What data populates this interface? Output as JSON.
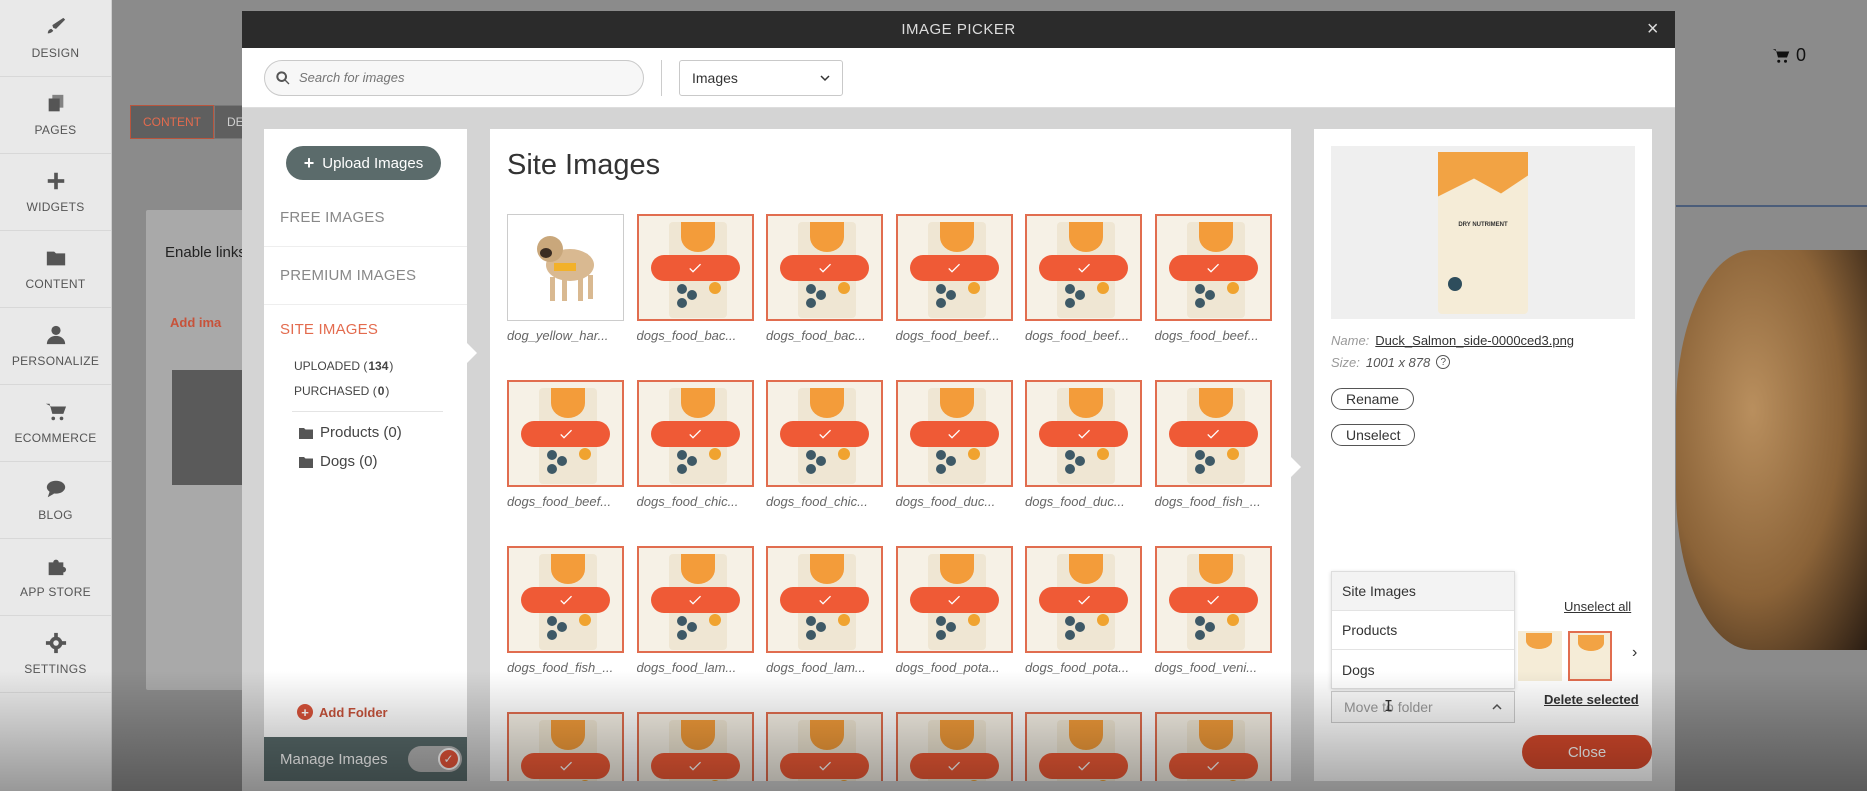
{
  "sidebar": {
    "items": [
      {
        "label": "DESIGN",
        "icon": "brush-icon"
      },
      {
        "label": "PAGES",
        "icon": "pages-icon"
      },
      {
        "label": "WIDGETS",
        "icon": "plus-icon"
      },
      {
        "label": "CONTENT",
        "icon": "folder-icon"
      },
      {
        "label": "PERSONALIZE",
        "icon": "person-icon"
      },
      {
        "label": "ECOMMERCE",
        "icon": "cart-icon"
      },
      {
        "label": "BLOG",
        "icon": "chat-icon"
      },
      {
        "label": "APP STORE",
        "icon": "puzzle-icon"
      },
      {
        "label": "SETTINGS",
        "icon": "gear-icon"
      }
    ]
  },
  "background": {
    "tab_content": "CONTENT",
    "tab_design": "DE",
    "enable_links": "Enable links",
    "add_image": "Add ima",
    "cart_count": "0"
  },
  "modal": {
    "title": "IMAGE PICKER",
    "close_icon": "×",
    "search_placeholder": "Search for images",
    "filter_selected": "Images",
    "upload_label": "Upload Images",
    "nav": {
      "free": "FREE IMAGES",
      "premium": "PREMIUM IMAGES",
      "site": "SITE IMAGES",
      "uploaded_label": "UPLOADED",
      "uploaded_count": "134",
      "purchased_label": "PURCHASED",
      "purchased_count": "0"
    },
    "folders": [
      {
        "name": "Products (0)"
      },
      {
        "name": "Dogs (0)"
      }
    ],
    "add_folder": "Add Folder",
    "manage_images": "Manage Images",
    "grid_title": "Site Images",
    "images": [
      {
        "name": "dog_yellow_har...",
        "selected": false,
        "kind": "pug"
      },
      {
        "name": "dogs_food_bac...",
        "selected": true,
        "kind": "bag"
      },
      {
        "name": "dogs_food_bac...",
        "selected": true,
        "kind": "bag"
      },
      {
        "name": "dogs_food_beef...",
        "selected": true,
        "kind": "bag"
      },
      {
        "name": "dogs_food_beef...",
        "selected": true,
        "kind": "bag"
      },
      {
        "name": "dogs_food_beef...",
        "selected": true,
        "kind": "bag"
      },
      {
        "name": "dogs_food_beef...",
        "selected": true,
        "kind": "bag"
      },
      {
        "name": "dogs_food_chic...",
        "selected": true,
        "kind": "bag"
      },
      {
        "name": "dogs_food_chic...",
        "selected": true,
        "kind": "bag"
      },
      {
        "name": "dogs_food_duc...",
        "selected": true,
        "kind": "bag"
      },
      {
        "name": "dogs_food_duc...",
        "selected": true,
        "kind": "bag"
      },
      {
        "name": "dogs_food_fish_...",
        "selected": true,
        "kind": "bag"
      },
      {
        "name": "dogs_food_fish_...",
        "selected": true,
        "kind": "bag"
      },
      {
        "name": "dogs_food_lam...",
        "selected": true,
        "kind": "bag"
      },
      {
        "name": "dogs_food_lam...",
        "selected": true,
        "kind": "bag"
      },
      {
        "name": "dogs_food_pota...",
        "selected": true,
        "kind": "bag"
      },
      {
        "name": "dogs_food_pota...",
        "selected": true,
        "kind": "bag"
      },
      {
        "name": "dogs_food_veni...",
        "selected": true,
        "kind": "bag"
      },
      {
        "name": "",
        "selected": true,
        "kind": "bag"
      },
      {
        "name": "",
        "selected": true,
        "kind": "bag"
      },
      {
        "name": "",
        "selected": true,
        "kind": "bag"
      },
      {
        "name": "",
        "selected": true,
        "kind": "bag"
      },
      {
        "name": "",
        "selected": true,
        "kind": "bag"
      },
      {
        "name": "",
        "selected": true,
        "kind": "bag"
      }
    ],
    "details": {
      "preview_text": "DRY NUTRIMENT",
      "name_label": "Name:",
      "name_value": "Duck_Salmon_side-0000ced3.png",
      "size_label": "Size:",
      "size_value": "1001 x 878",
      "help_icon": "?",
      "rename": "Rename",
      "unselect": "Unselect",
      "unselect_all": "Unselect all",
      "move_options": [
        "Site Images",
        "Products",
        "Dogs"
      ],
      "move_placeholder": "Move to folder",
      "delete_selected": "Delete selected",
      "next_icon": "›"
    },
    "close_button": "Close"
  },
  "colors": {
    "accent": "#e36b4e",
    "check": "#ef5a36",
    "header": "#2b2b2b",
    "manage_bar": "#586a6a"
  }
}
